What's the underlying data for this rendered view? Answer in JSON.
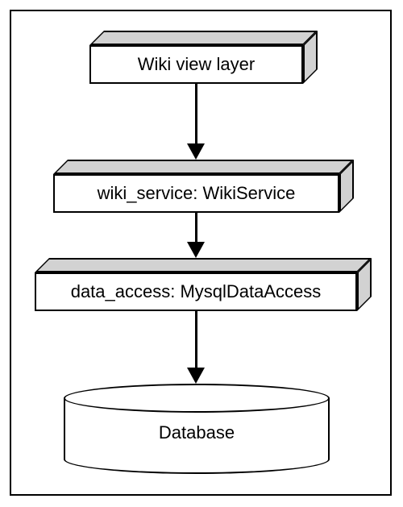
{
  "layers": {
    "view": {
      "label": "Wiki view layer"
    },
    "service": {
      "label": "wiki_service: WikiService"
    },
    "data_access": {
      "label": "data_access: MysqlDataAccess"
    },
    "database": {
      "label": "Database"
    }
  }
}
